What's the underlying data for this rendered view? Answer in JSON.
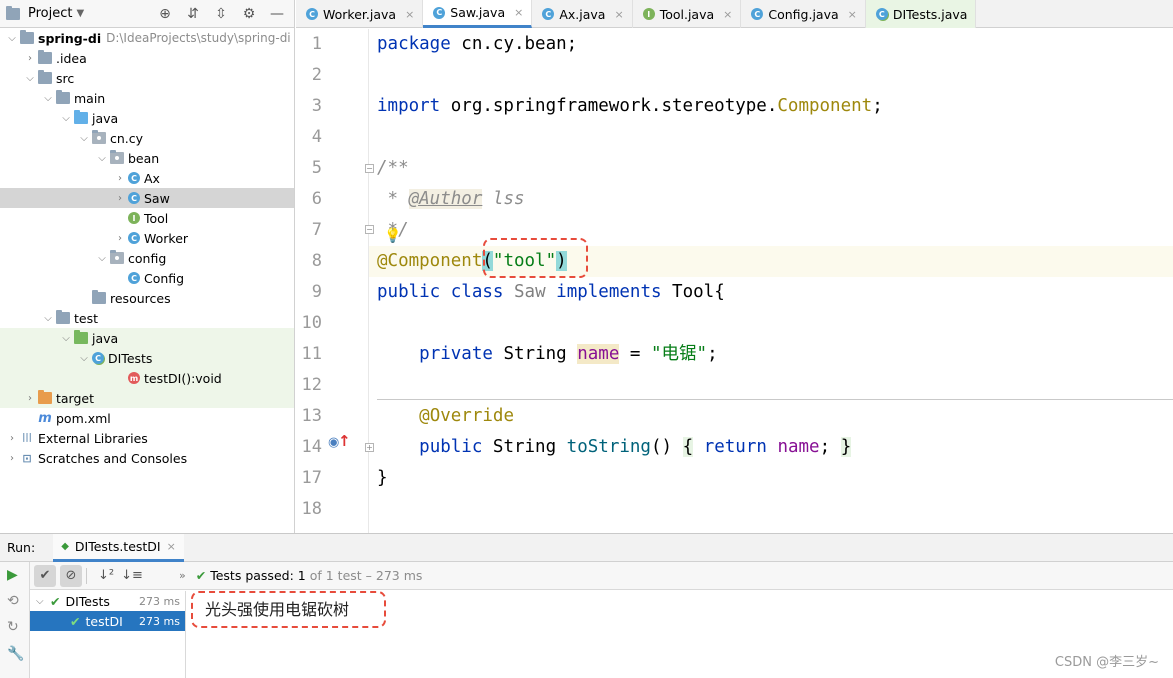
{
  "project_panel": {
    "title": "Project",
    "tree": [
      {
        "label": "spring-di",
        "extra": "D:\\IdeaProjects\\study\\spring-di",
        "depth": 0,
        "arrow": "open",
        "icon": "module",
        "bold": true
      },
      {
        "label": ".idea",
        "depth": 1,
        "arrow": "closed",
        "icon": "folder"
      },
      {
        "label": "src",
        "depth": 1,
        "arrow": "open",
        "icon": "folder"
      },
      {
        "label": "main",
        "depth": 2,
        "arrow": "open",
        "icon": "folder"
      },
      {
        "label": "java",
        "depth": 3,
        "arrow": "open",
        "icon": "folder-blue"
      },
      {
        "label": "cn.cy",
        "depth": 4,
        "arrow": "open",
        "icon": "package"
      },
      {
        "label": "bean",
        "depth": 5,
        "arrow": "open",
        "icon": "package"
      },
      {
        "label": "Ax",
        "depth": 6,
        "arrow": "closed",
        "icon": "class"
      },
      {
        "label": "Saw",
        "depth": 6,
        "arrow": "closed",
        "icon": "class",
        "selected": true
      },
      {
        "label": "Tool",
        "depth": 6,
        "arrow": "none",
        "icon": "interface"
      },
      {
        "label": "Worker",
        "depth": 6,
        "arrow": "closed",
        "icon": "class"
      },
      {
        "label": "config",
        "depth": 5,
        "arrow": "open",
        "icon": "package"
      },
      {
        "label": "Config",
        "depth": 6,
        "arrow": "none",
        "icon": "class"
      },
      {
        "label": "resources",
        "depth": 4,
        "arrow": "none",
        "icon": "folder"
      },
      {
        "label": "test",
        "depth": 2,
        "arrow": "open",
        "icon": "folder"
      },
      {
        "label": "java",
        "depth": 3,
        "arrow": "open",
        "icon": "folder-green",
        "test": true
      },
      {
        "label": "DITests",
        "depth": 4,
        "arrow": "open",
        "icon": "class-test",
        "test": true
      },
      {
        "label": "testDI():void",
        "depth": 6,
        "arrow": "none",
        "icon": "method",
        "test": true
      },
      {
        "label": "target",
        "depth": 1,
        "arrow": "closed",
        "icon": "folder-orange",
        "test": true
      },
      {
        "label": "pom.xml",
        "depth": 1,
        "arrow": "none",
        "icon": "maven"
      },
      {
        "label": "External Libraries",
        "depth": 0,
        "arrow": "closed",
        "icon": "libraries"
      },
      {
        "label": "Scratches and Consoles",
        "depth": 0,
        "arrow": "closed",
        "icon": "scratches"
      }
    ]
  },
  "tabs": [
    {
      "label": "Worker.java",
      "icon": "class"
    },
    {
      "label": "Saw.java",
      "icon": "class",
      "active": true
    },
    {
      "label": "Ax.java",
      "icon": "class"
    },
    {
      "label": "Tool.java",
      "icon": "interface"
    },
    {
      "label": "Config.java",
      "icon": "class"
    },
    {
      "label": "DITests.java",
      "icon": "class-test",
      "test": true
    }
  ],
  "editor": {
    "line_numbers": [
      "1",
      "2",
      "3",
      "4",
      "5",
      "6",
      "7",
      "8",
      "9",
      "10",
      "11",
      "12",
      "13",
      "14",
      "17",
      "18"
    ],
    "code": {
      "l1_kw": "package",
      "l1_rest": " cn.cy.bean;",
      "l3_kw": "import",
      "l3_rest": " org.springframework.stereotype.",
      "l3_cls": "Component",
      "l3_end": ";",
      "l5": "/**",
      "l6_star": " * ",
      "l6_tag": "@Author",
      "l6_rest": " lss",
      "l7": " */",
      "l8_ann": "@Component",
      "l8_open": "(",
      "l8_str": "\"tool\"",
      "l8_close": ")",
      "l9_kw1": "public",
      "l9_kw2": "class",
      "l9_cls": "Saw",
      "l9_kw3": "implements",
      "l9_rest": " Tool{",
      "l11_kw": "private",
      "l11_type": " String ",
      "l11_field": "name",
      "l11_eq": " = ",
      "l11_str": "\"电锯\"",
      "l11_end": ";",
      "l13_ann": "@Override",
      "l14_kw1": "public",
      "l14_type": " String ",
      "l14_meth": "toString",
      "l14_parens": "()",
      "l14_brace1": "{",
      "l14_kw2": "return",
      "l14_field": "name",
      "l14_semi": ";",
      "l14_brace2": "}",
      "l17": "}"
    }
  },
  "run_panel": {
    "run_label": "Run:",
    "tab_label": "DITests.testDI",
    "status_prefix": "Tests passed:",
    "status_count": "1",
    "status_rest": "of 1 test – 273 ms",
    "tests": [
      {
        "label": "DITests",
        "time": "273 ms"
      },
      {
        "label": "testDI",
        "time": "273 ms",
        "selected": true
      }
    ],
    "console_output": "光头强使用电锯砍树"
  },
  "watermark": "CSDN @李三岁~",
  "colors": {
    "accent": "#4083c9",
    "selection": "#2675bf",
    "annotation_box": "#e74c3c"
  }
}
